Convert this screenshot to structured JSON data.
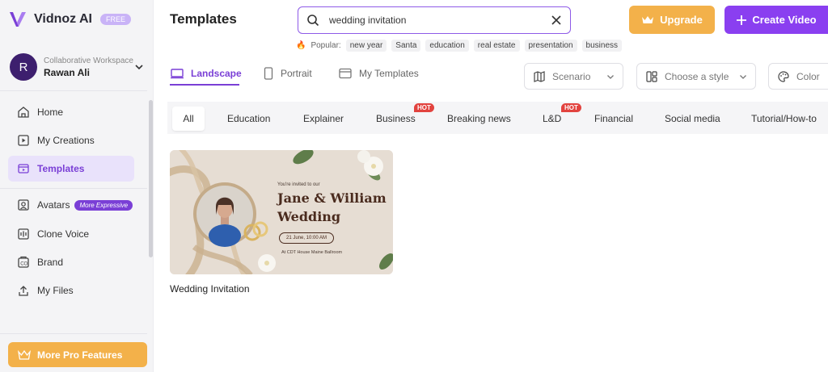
{
  "brand": {
    "name": "Vidnoz AI",
    "badge": "FREE"
  },
  "workspace": {
    "avatar_initial": "R",
    "label": "Collaborative Workspace",
    "user": "Rawan Ali"
  },
  "nav": [
    {
      "label": "Home",
      "icon": "home-icon"
    },
    {
      "label": "My Creations",
      "icon": "play-icon"
    },
    {
      "label": "Templates",
      "icon": "template-icon",
      "active": true
    },
    {
      "label": "Avatars",
      "icon": "avatar-icon",
      "badge": "More Expressive"
    },
    {
      "label": "Clone Voice",
      "icon": "waveform-icon"
    },
    {
      "label": "Brand",
      "icon": "brand-icon"
    },
    {
      "label": "My Files",
      "icon": "upload-icon"
    }
  ],
  "pro_button": "More Pro Features",
  "page": {
    "title": "Templates"
  },
  "search": {
    "value": "wedding invitation",
    "placeholder": ""
  },
  "popular": {
    "label": "Popular:",
    "tags": [
      "new year",
      "Santa",
      "education",
      "real estate",
      "presentation",
      "business"
    ]
  },
  "actions": {
    "upgrade": "Upgrade",
    "create": "Create Video"
  },
  "orientation_tabs": [
    {
      "label": "Landscape",
      "active": true
    },
    {
      "label": "Portrait"
    },
    {
      "label": "My Templates"
    }
  ],
  "filters": {
    "scenario": "Scenario",
    "style": "Choose a style",
    "color": "Color"
  },
  "categories": [
    {
      "label": "All",
      "active": true
    },
    {
      "label": "Education"
    },
    {
      "label": "Explainer"
    },
    {
      "label": "Business",
      "hot": "HOT"
    },
    {
      "label": "Breaking news"
    },
    {
      "label": "L&D",
      "hot": "HOT"
    },
    {
      "label": "Financial"
    },
    {
      "label": "Social media"
    },
    {
      "label": "Tutorial/How-to"
    }
  ],
  "template": {
    "name": "Wedding Invitation",
    "invite_line": "You're invited to our",
    "couple": "Jane & William",
    "event": "Wedding",
    "date": "21 June, 10:00 AM",
    "venue": "At CDT House Maine Ballroom"
  },
  "colors": {
    "accent": "#7a3fd6",
    "create": "#8a3ff0",
    "gold": "#f3b14a",
    "hot": "#e2433f"
  }
}
